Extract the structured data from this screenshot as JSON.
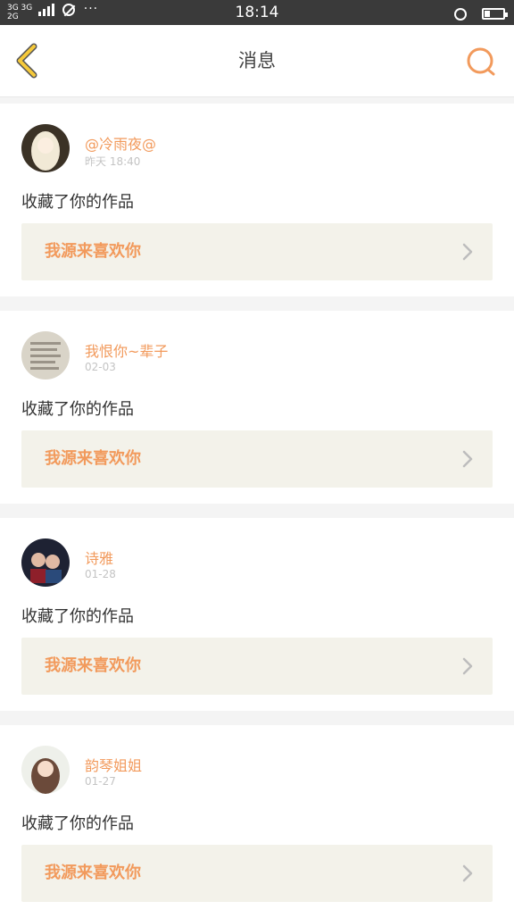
{
  "status_bar": {
    "network_top": "3G 3G",
    "network_bottom": "2G",
    "dots": "···",
    "time": "18:14",
    "battery_percent": 30
  },
  "header": {
    "title": "消息",
    "back_icon": "chevron-left-icon",
    "search_icon": "search-icon"
  },
  "colors": {
    "accent": "#f29a5c",
    "back_icon": "#f5c93a",
    "work_bg": "#f3f2ea"
  },
  "messages": [
    {
      "username": "@冷雨夜@",
      "time": "昨天 18:40",
      "action": "收藏了你的作品",
      "work_title": "我源来喜欢你"
    },
    {
      "username": "我恨你~辈子",
      "time": "02-03",
      "action": "收藏了你的作品",
      "work_title": "我源来喜欢你"
    },
    {
      "username": "诗雅",
      "time": "01-28",
      "action": "收藏了你的作品",
      "work_title": "我源来喜欢你"
    },
    {
      "username": "韵琴姐姐",
      "time": "01-27",
      "action": "收藏了你的作品",
      "work_title": "我源来喜欢你"
    }
  ]
}
